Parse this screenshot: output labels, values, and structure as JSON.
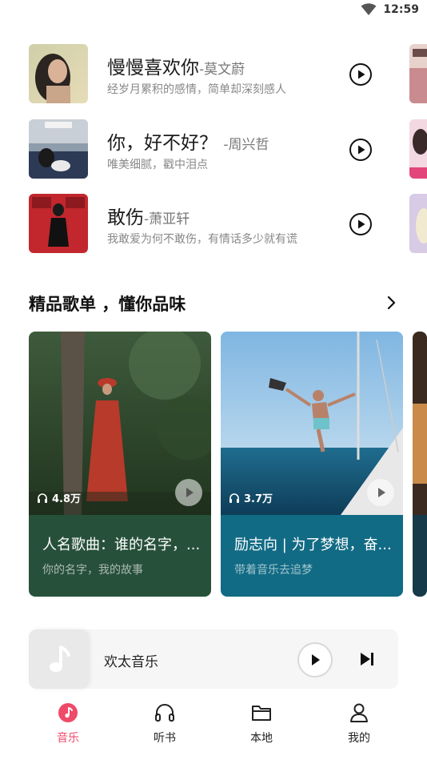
{
  "status": {
    "time": "12:59"
  },
  "songs": [
    {
      "title": "慢慢喜欢你",
      "artist": "-莫文蔚",
      "subtitle": "经岁月累积的感情，简单却深刻感人"
    },
    {
      "title": "你，好不好？",
      "artist": "-周兴哲",
      "subtitle": "唯美细腻，戳中泪点"
    },
    {
      "title": "敢伤",
      "artist": "-萧亚轩",
      "subtitle": "我敢爱为何不敢伤，有情话多少就有谎"
    }
  ],
  "playlists_section": {
    "title": "精品歌单 ，懂你品味"
  },
  "playlists": [
    {
      "count": "4.8万",
      "title": "人名歌曲：谁的名字，...",
      "subtitle": "你的名字，我的故事",
      "color": "#27503a"
    },
    {
      "count": "3.7万",
      "title": "励志向 | 为了梦想，奋...",
      "subtitle": "带着音乐去追梦",
      "color": "#126b84"
    }
  ],
  "player": {
    "name": "欢太音乐"
  },
  "tabs": [
    {
      "label": "音乐",
      "icon": "music-disc-icon",
      "active": true
    },
    {
      "label": "听书",
      "icon": "headphones-icon",
      "active": false
    },
    {
      "label": "本地",
      "icon": "folder-icon",
      "active": false
    },
    {
      "label": "我的",
      "icon": "person-icon",
      "active": false
    }
  ],
  "colors": {
    "accent": "#ef4a68",
    "card1": "#27503a",
    "card2": "#126b84"
  }
}
